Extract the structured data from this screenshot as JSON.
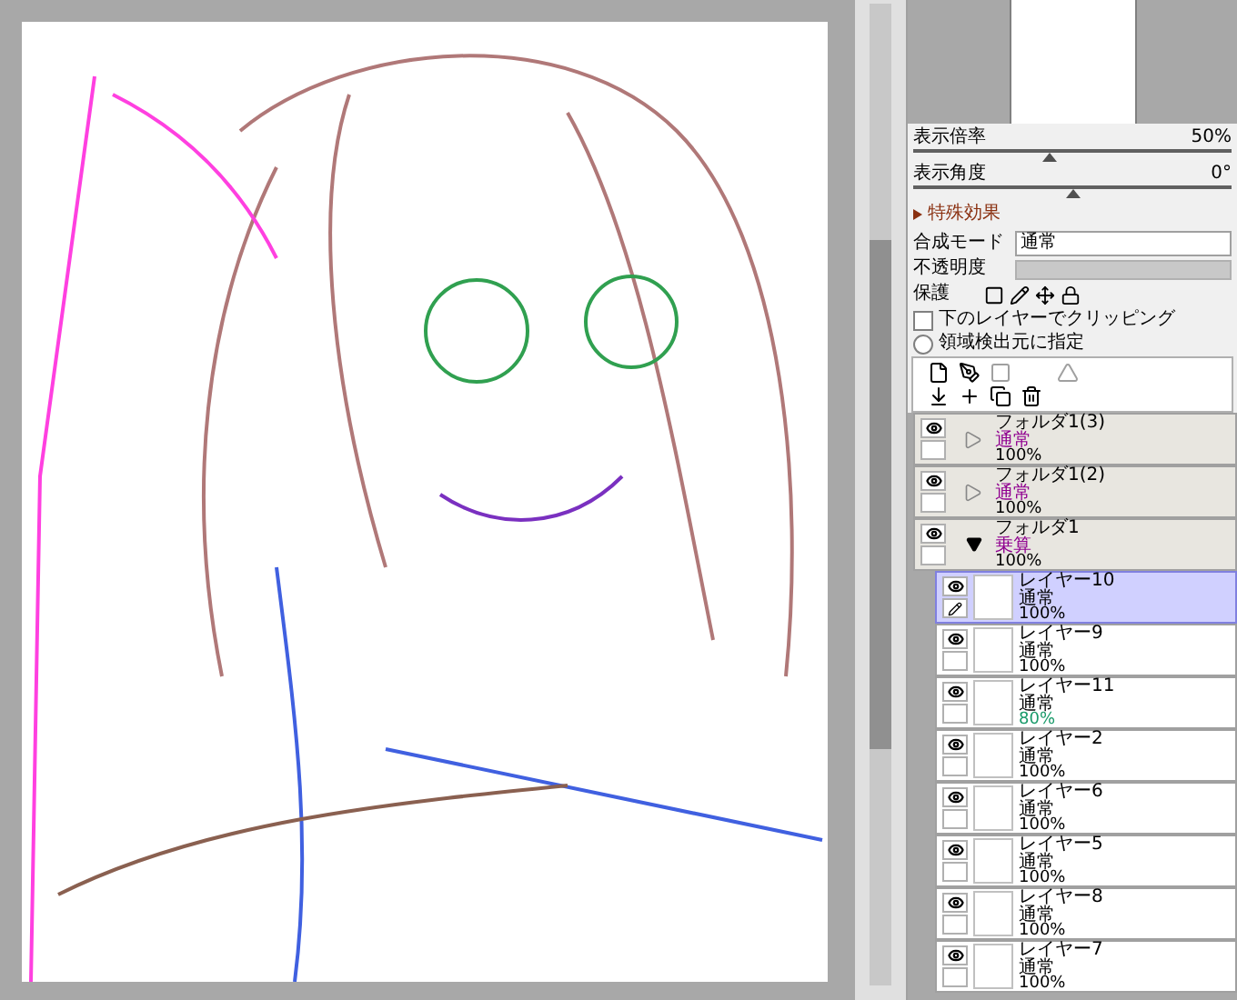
{
  "navigator": {
    "sliders": [
      {
        "label": "表示倍率",
        "reading": "50%",
        "level": 0.43
      },
      {
        "label": "表示角度",
        "reading": "0°",
        "level": 0.5
      }
    ]
  },
  "effects": {
    "label": "特殊効果",
    "expanded": false
  },
  "layer_props": {
    "blend_label": "合成モード",
    "blend_value": "通常",
    "opacity": {
      "label": "不透明度",
      "level": 1
    },
    "protect_label": "保護",
    "clipping": {
      "label": "下のレイヤーでクリッピング",
      "checked": false
    },
    "detect": {
      "label": "領域検出元に指定",
      "selected": false
    }
  },
  "layers": [
    {
      "kind": "folder",
      "name": "フォルダ1(3)",
      "mode": "通常",
      "opacity": "100%",
      "color": "#000000",
      "expanded": false,
      "selected": false
    },
    {
      "kind": "folder",
      "name": "フォルダ1(2)",
      "mode": "通常",
      "opacity": "100%",
      "color": "#000000",
      "expanded": false,
      "selected": false
    },
    {
      "kind": "folder",
      "name": "フォルダ1",
      "mode": "乗算",
      "opacity": "100%",
      "color": "#000000",
      "expanded": true,
      "selected": false,
      "children": [
        {
          "kind": "layer",
          "name": "レイヤー10",
          "mode": "通常",
          "opacity": "100%",
          "color": "#000000",
          "selected": true
        },
        {
          "kind": "layer",
          "name": "レイヤー9",
          "mode": "通常",
          "opacity": "100%",
          "color": "#000000",
          "selected": false
        },
        {
          "kind": "layer",
          "name": "レイヤー11",
          "mode": "通常",
          "opacity": "80%",
          "color": "#1a9a6a",
          "selected": false
        },
        {
          "kind": "layer",
          "name": "レイヤー2",
          "mode": "通常",
          "opacity": "100%",
          "color": "#000000",
          "selected": false
        },
        {
          "kind": "layer",
          "name": "レイヤー6",
          "mode": "通常",
          "opacity": "100%",
          "color": "#000000",
          "selected": false
        },
        {
          "kind": "layer",
          "name": "レイヤー5",
          "mode": "通常",
          "opacity": "100%",
          "color": "#000000",
          "selected": false
        },
        {
          "kind": "layer",
          "name": "レイヤー8",
          "mode": "通常",
          "opacity": "100%",
          "color": "#000000",
          "selected": false
        },
        {
          "kind": "layer",
          "name": "レイヤー7",
          "mode": "通常",
          "opacity": "100%",
          "color": "#000000",
          "selected": false
        }
      ]
    }
  ]
}
